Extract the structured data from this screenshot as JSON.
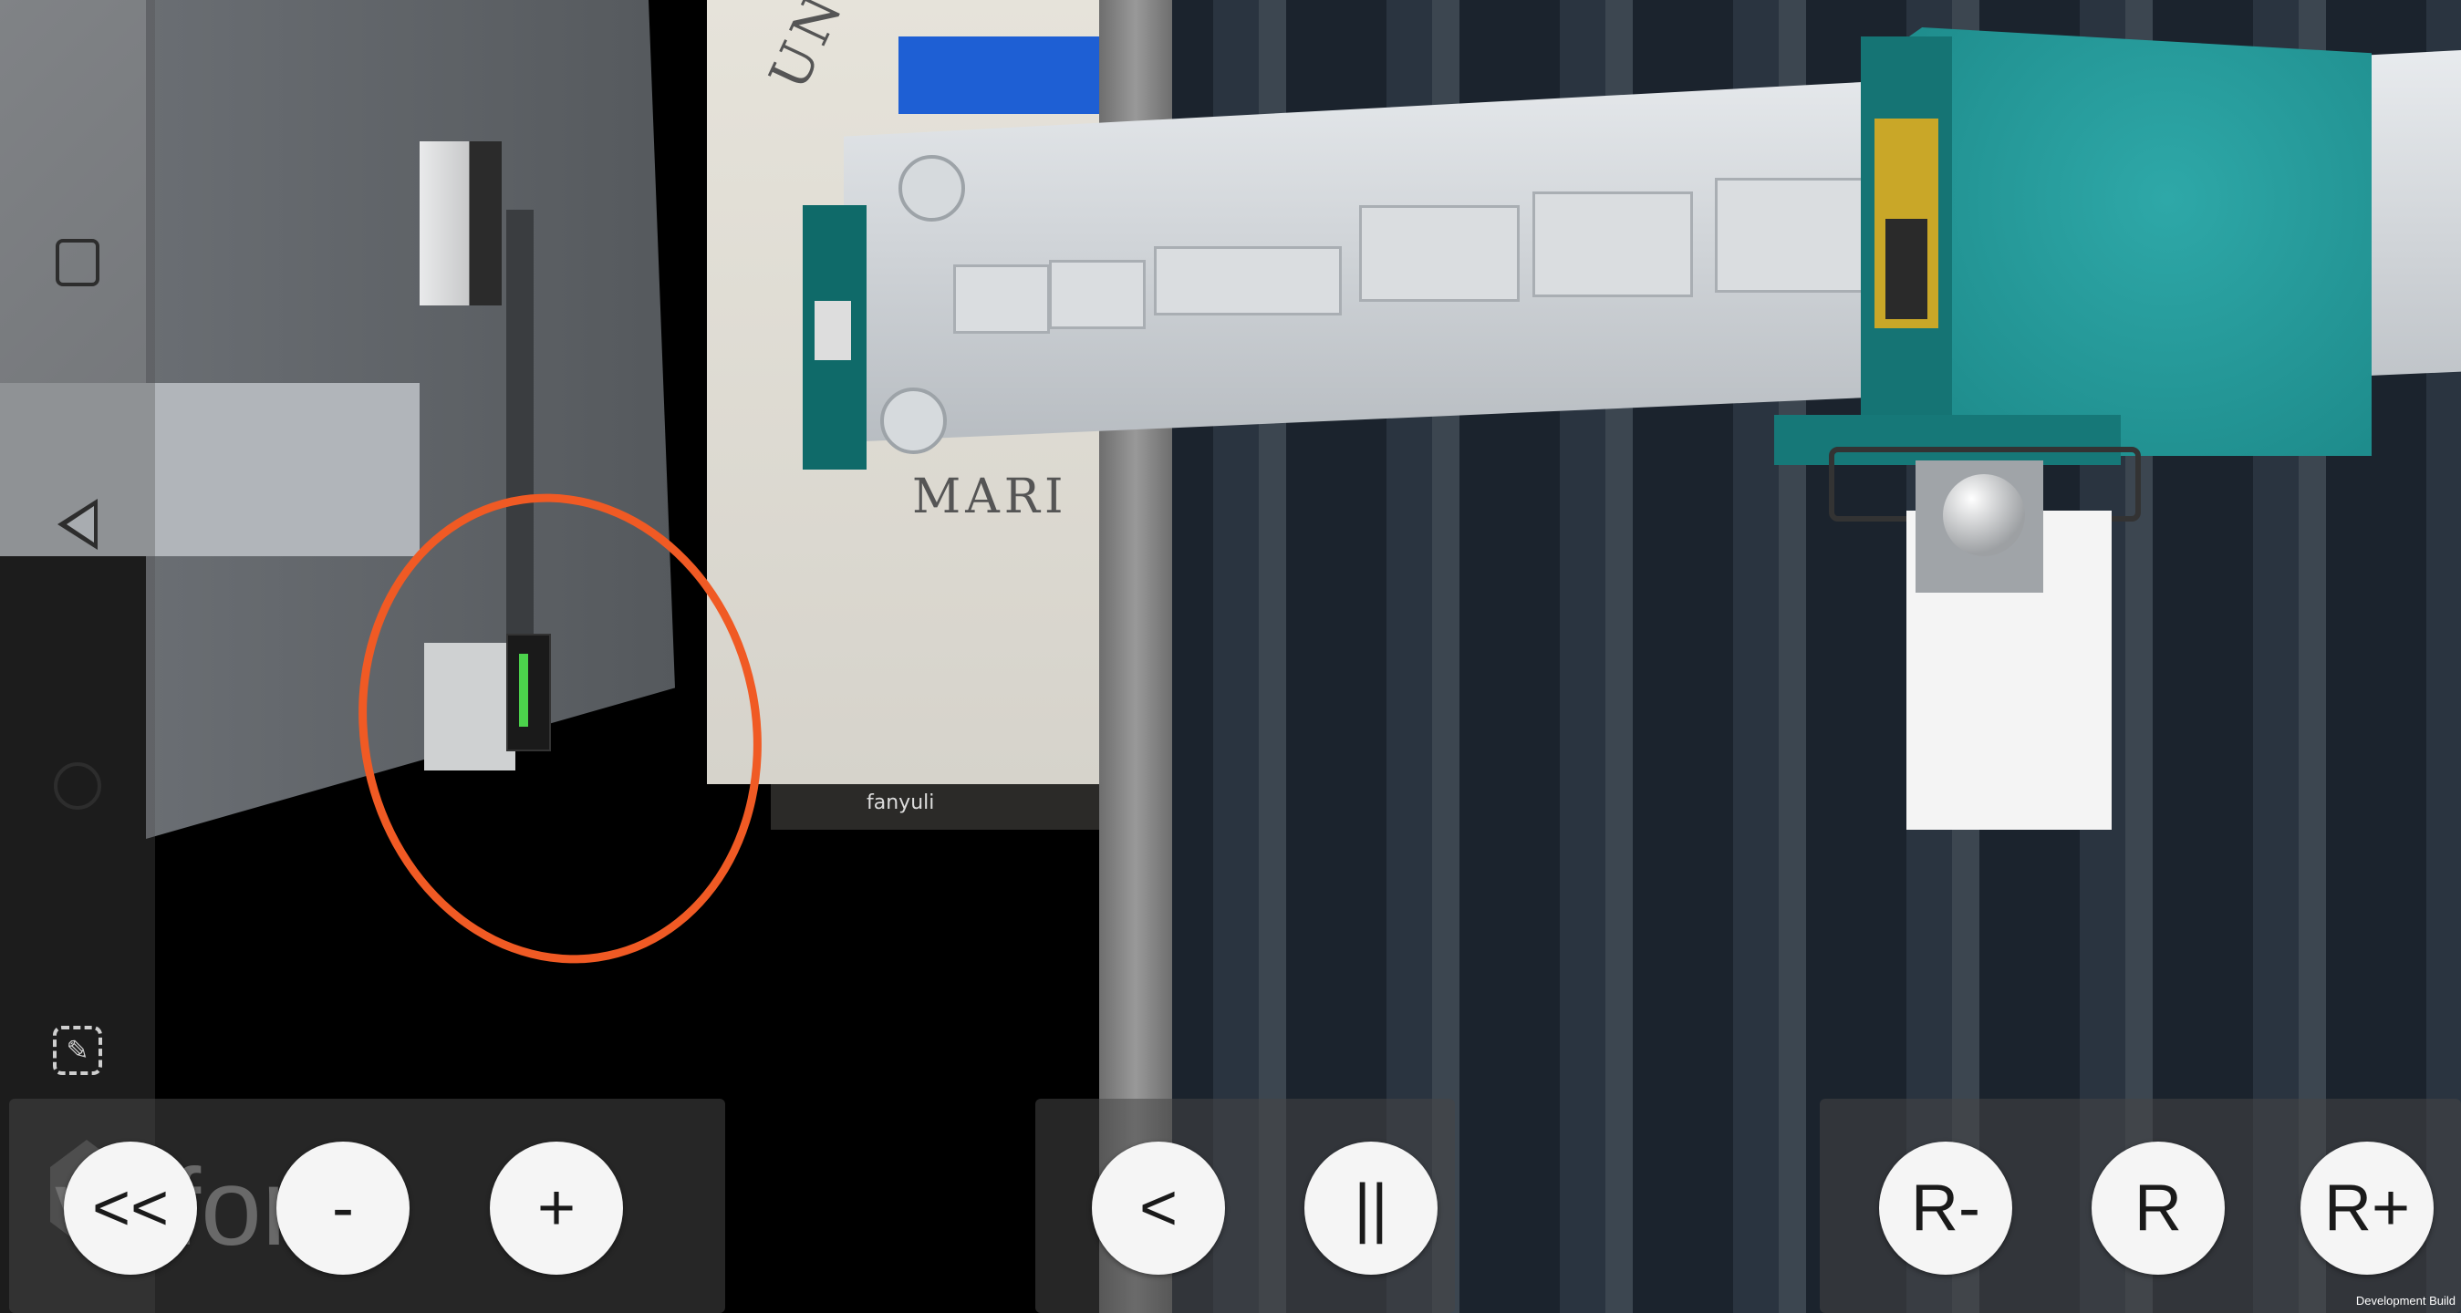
{
  "background_document": {
    "header_text": "UNIVERSI",
    "bottom_text": "MARI",
    "taskbar_label": "fanyuli"
  },
  "brand": {
    "text": "vuforia"
  },
  "left_panel": {
    "back_label": "<<",
    "minus_label": "-",
    "plus_label": "+"
  },
  "center_panel": {
    "prev_label": "<",
    "pause_label": "||"
  },
  "right_panel": {
    "rotate_minus_label": "R-",
    "rotate_label": "R",
    "rotate_plus_label": "R+"
  },
  "watermark": "Development Build",
  "colors": {
    "annotation": "#f05a24",
    "gripper": "#1a8585",
    "led": "#4cd24c"
  }
}
